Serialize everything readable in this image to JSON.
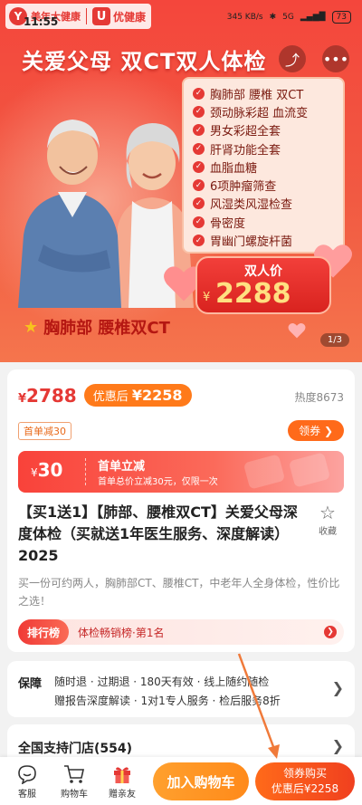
{
  "status_bar": {
    "time": "11:55",
    "speed": "345 KB/s",
    "network": "5G",
    "battery": "73"
  },
  "brand": {
    "logo_main": "美年大健康",
    "logo_sub": "优健康"
  },
  "hero": {
    "title": "关爱父母  双CT双人体检",
    "features": [
      "胸肺部 腰椎 双CT",
      "颈动脉彩超 血流变",
      "男女彩超全套",
      "肝肾功能全套",
      "血脂血糖",
      "6项肿瘤筛查",
      "风湿类风湿检查",
      "骨密度",
      "胃幽门螺旋杆菌"
    ],
    "price_label": "双人价",
    "price_symbol": "¥",
    "price_value": "2288",
    "subtitle": "胸肺部  腰椎双CT",
    "pager": "1/3"
  },
  "product": {
    "original_price_symbol": "¥",
    "original_price": "2788",
    "discount_prefix": "优惠后",
    "discount_price": "¥2258",
    "heat": "热度8673",
    "first_order_tag": "首单减30",
    "coupon_button": "领券 ❯",
    "coupon": {
      "amount_symbol": "¥",
      "amount": "30",
      "title": "首单立减",
      "desc": "首单总价立减30元，仅限一次"
    },
    "title": "【买1送1】【肺部、腰椎双CT】关爱父母深度体检（买就送1年医生服务、深度解读）2025",
    "favorite_label": "收藏",
    "description": "买一份可约两人，胸肺部CT、腰椎CT，中老年人全身体检，性价比之选！",
    "rank_badge": "排行榜",
    "rank_text": "体检畅销榜·第1名"
  },
  "guarantee": {
    "label": "保障",
    "line1": "随时退 · 过期退 · 180天有效 · 线上随约随检",
    "line2": "赠报告深度解读 · 1对1专人服务 · 检后服务8折"
  },
  "stores": {
    "title": "全国支持门店(554)"
  },
  "bottom_bar": {
    "service": "客服",
    "cart": "购物车",
    "gift": "赠亲友",
    "add_to_cart": "加入购物车",
    "buy_line1": "领券购买",
    "buy_line2": "优惠后¥2258"
  },
  "colors": {
    "brand_red": "#e53935",
    "orange": "#ff7a1a",
    "annotation_arrow": "#f07a3a"
  }
}
